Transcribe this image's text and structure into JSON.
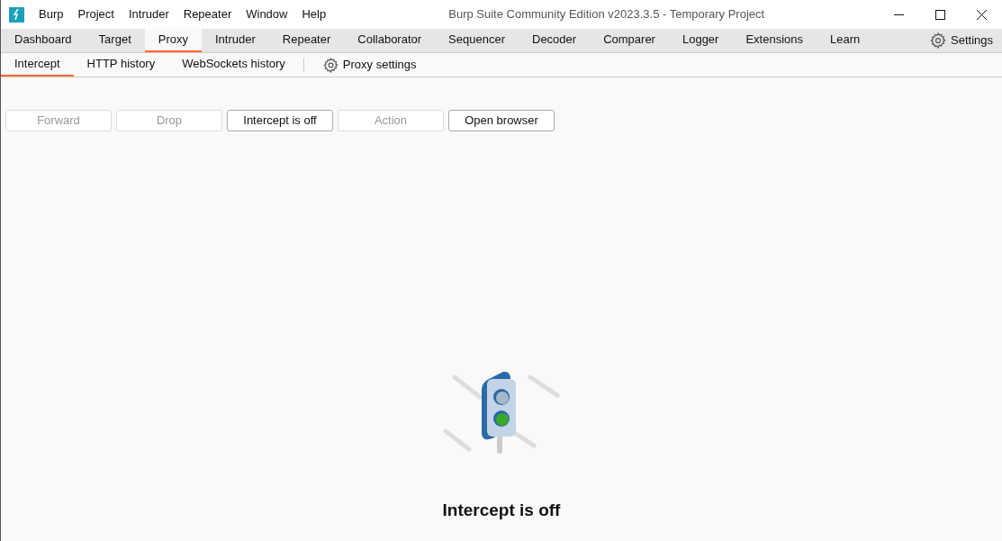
{
  "window": {
    "title": "Burp Suite Community Edition v2023.3.5 - Temporary Project"
  },
  "menu": [
    "Burp",
    "Project",
    "Intruder",
    "Repeater",
    "Window",
    "Help"
  ],
  "tabs": [
    {
      "label": "Dashboard",
      "selected": false
    },
    {
      "label": "Target",
      "selected": false
    },
    {
      "label": "Proxy",
      "selected": true
    },
    {
      "label": "Intruder",
      "selected": false
    },
    {
      "label": "Repeater",
      "selected": false
    },
    {
      "label": "Collaborator",
      "selected": false
    },
    {
      "label": "Sequencer",
      "selected": false
    },
    {
      "label": "Decoder",
      "selected": false
    },
    {
      "label": "Comparer",
      "selected": false
    },
    {
      "label": "Logger",
      "selected": false
    },
    {
      "label": "Extensions",
      "selected": false
    },
    {
      "label": "Learn",
      "selected": false
    }
  ],
  "settings": "Settings",
  "subtabs": [
    {
      "label": "Intercept",
      "selected": true
    },
    {
      "label": "HTTP history",
      "selected": false
    },
    {
      "label": "WebSockets history",
      "selected": false
    }
  ],
  "proxy_settings": "Proxy settings",
  "buttons": [
    {
      "label": "Forward",
      "disabled": true
    },
    {
      "label": "Drop",
      "disabled": true
    },
    {
      "label": "Intercept is off",
      "disabled": false
    },
    {
      "label": "Action",
      "disabled": true
    },
    {
      "label": "Open browser",
      "disabled": false
    }
  ],
  "status_message": "Intercept is off"
}
